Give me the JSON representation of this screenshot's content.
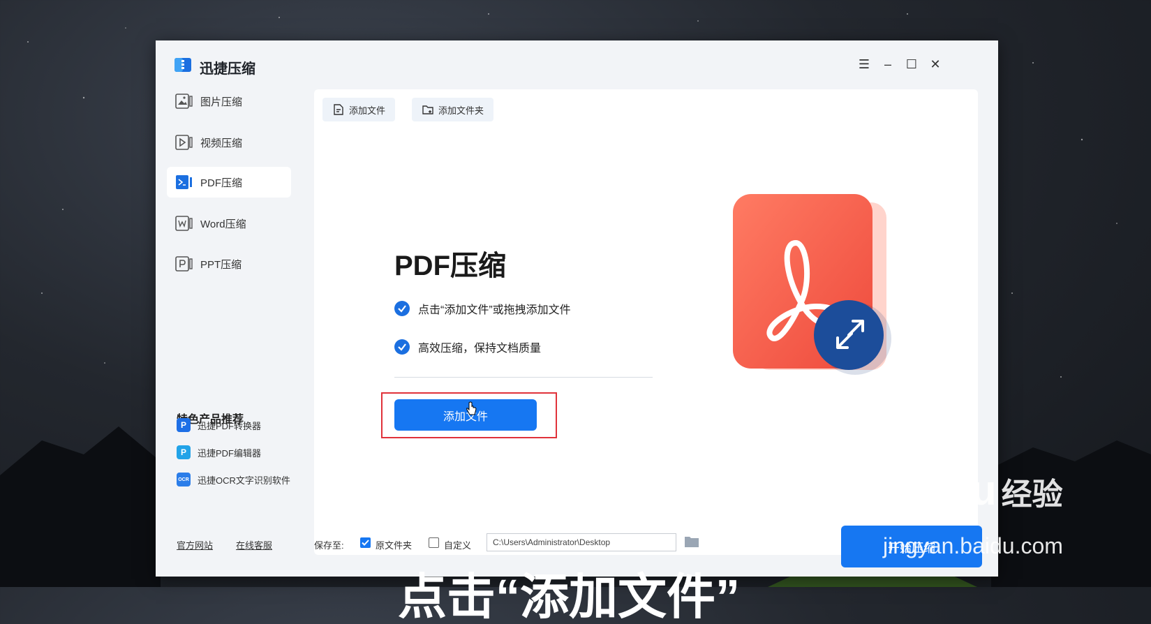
{
  "app": {
    "title": "迅捷压缩"
  },
  "window_controls": {
    "menu": "☰",
    "minimize": "–",
    "maximize": "☐",
    "close": "✕"
  },
  "sidebar": {
    "items": [
      {
        "label": "图片压缩",
        "icon": "image-icon"
      },
      {
        "label": "视频压缩",
        "icon": "video-icon"
      },
      {
        "label": "PDF压缩",
        "icon": "pdf-icon",
        "active": true
      },
      {
        "label": "Word压缩",
        "icon": "word-icon"
      },
      {
        "label": "PPT压缩",
        "icon": "ppt-icon"
      }
    ],
    "promo_title": "特色产品推荐",
    "promos": [
      {
        "label": "迅捷PDF转换器",
        "icon_text": "P",
        "color": "#1e6fe6"
      },
      {
        "label": "迅捷PDF编辑器",
        "icon_text": "P",
        "color": "#22a3e8"
      },
      {
        "label": "迅捷OCR文字识别软件",
        "icon_text": "OCR",
        "color": "#2b7de9"
      }
    ],
    "footer": {
      "website": "官方网站",
      "support": "在线客服"
    }
  },
  "toolbar": {
    "add_file": "添加文件",
    "add_folder": "添加文件夹"
  },
  "hero": {
    "title": "PDF压缩",
    "features": [
      "点击“添加文件”或拖拽添加文件",
      "高效压缩，保持文档质量"
    ],
    "add_button": "添加文件"
  },
  "bottom": {
    "save_to": "保存至:",
    "option_original": "原文件夹",
    "option_custom": "自定义",
    "original_checked": true,
    "custom_checked": false,
    "path": "C:\\Users\\Administrator\\Desktop",
    "start_button": "开始压缩"
  },
  "overlay": {
    "watermark_logo": "Baidu",
    "watermark_cn": "经验",
    "watermark_url": "jingyan.baidu.com",
    "subtitle": "点击“添加文件”"
  },
  "colors": {
    "accent": "#1677f2",
    "highlight": "#e0323a",
    "pdf_red": "#f25a45"
  }
}
